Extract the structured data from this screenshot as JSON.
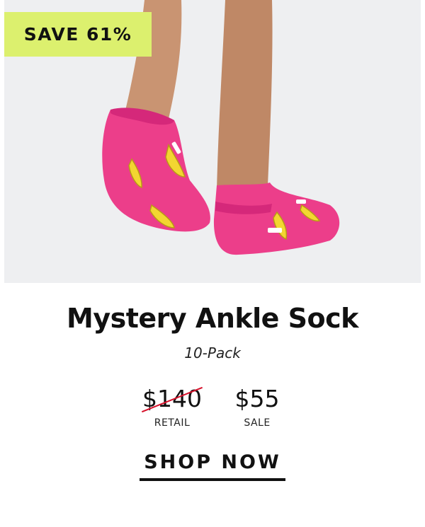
{
  "hero": {
    "image_description_icon": "pink-banana-ankle-socks-photo",
    "badge": "SAVE 61%"
  },
  "product": {
    "title": "Mystery Ankle Sock",
    "subtitle": "10-Pack"
  },
  "pricing": {
    "retail_price": "$140",
    "retail_label": "RETAIL",
    "sale_price": "$55",
    "sale_label": "SALE"
  },
  "cta": {
    "label": "SHOP NOW"
  },
  "colors": {
    "badge_bg": "#dcf06e",
    "sock_pink": "#ec3e8a",
    "strike_red": "#d6102a",
    "hero_bg": "#eeeff1"
  }
}
